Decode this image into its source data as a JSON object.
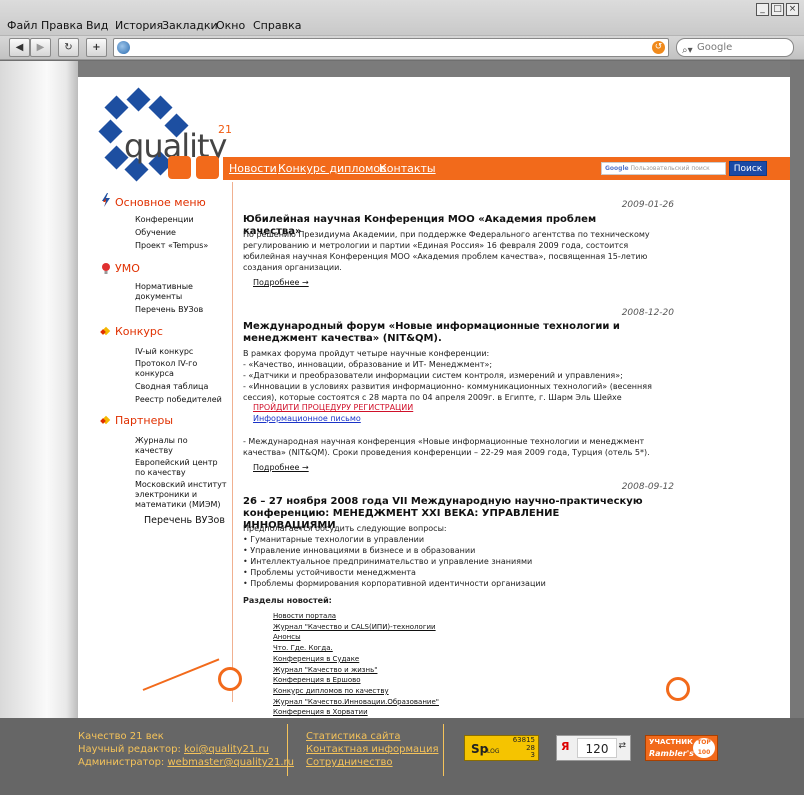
{
  "browser": {
    "menu": [
      "Файл",
      "Правка",
      "Вид",
      "История",
      "Закладки",
      "Окно",
      "Справка"
    ],
    "search_placeholder": "Google"
  },
  "site": {
    "logo_word": "quality",
    "logo_sup": "21",
    "nav": [
      "Новости",
      "Конкурс дипломов",
      "Контакты"
    ],
    "search_placeholder": "Пользовательский поиск",
    "search_button": "Поиск"
  },
  "sidebar": {
    "main_menu": {
      "title": "Основное меню",
      "items": [
        "Конференции",
        "Обучение",
        "Проект «Tempus»"
      ]
    },
    "umo": {
      "title": "УМО",
      "items": [
        "Нормативные документы",
        "Перечень ВУЗов"
      ]
    },
    "contest": {
      "title": "Конкурс",
      "items": [
        "IV-ый конкурс",
        "Протокол IV-го конкурса",
        "Сводная таблица",
        "Реестр победителей"
      ]
    },
    "partners": {
      "title": "Партнеры",
      "items": [
        "Журналы по качеству",
        "Европейский центр по качеству",
        "Московский институт электроники и математики (МИЭМ)"
      ]
    },
    "bottom": "Перечень ВУЗов"
  },
  "news": [
    {
      "date": "2009-01-26",
      "title": "Юбилейная научная Конференция МОО «Академия проблем качества»",
      "text": "По решению Президиума Академии, при поддержке Федерального агентства по техническому регулированию и метрологии и партии «Единая Россия» 16 февраля 2009 года, состоится юбилейная научная Конференция МОО «Академия проблем качества», посвященная 15-летию создания организации.",
      "more": "Подробнее →"
    },
    {
      "date": "2008-12-20",
      "title": "Международный форум «Новые информационные технологии и менеджмент качества» (NIT&QM).",
      "lines": [
        "В рамках форума пройдут четыре научные конференции:",
        "- «Качество, инновации, образование и ИТ- Менеджмент»;",
        "- «Датчики и преобразователи информации систем контроля, измерений и управления»;",
        "- «Инновации в условиях развития информационно- коммуникационных технологий» (весенняя",
        "сессия), которые состоятся с 28 марта по 04 апреля 2009г. в Египте, г. Шарм Эль Шейхе"
      ],
      "register_link": "ПРОЙДИТИ ПРОЦЕДУРУ РЕГИСТРАЦИИ",
      "info_link": "Информационное письмо",
      "extra": "- Международная научная конференция «Новые информационные технологии и менеджмент качества» (NIT&QM). Сроки проведения конференции – 22-29 мая 2009 года, Турция (отель 5*).",
      "more": "Подробнее →"
    },
    {
      "date": "2008-09-12",
      "title": "26 – 27 ноября 2008 года VII Международную научно-практическую конференцию: МЕНЕДЖМЕНТ XXI ВЕКА: УПРАВЛЕНИЕ ИННОВАЦИЯМИ",
      "intro": "Предполагается обсудить следующие вопросы:",
      "bullets": [
        "• Гуманитарные технологии в управлении",
        "• Управление инновациями в бизнесе и в образовании",
        "• Интеллектуальное предпринимательство и управление знаниями",
        "• Проблемы устойчивости менеджмента",
        "• Проблемы формирования корпоративной идентичности организации"
      ]
    }
  ],
  "sections": {
    "title": "Разделы новостей:",
    "items": [
      "Новости портала",
      "Журнал \"Качество и CALS(ИПИ)-технологии",
      "Анонсы",
      "Что. Где. Когда.",
      "Конференция в Судаке",
      "Журнал \"Качество и жизнь\"",
      "Конференция в Ершово",
      "Конкурс дипломов по качеству",
      "Журнал \"Качество.Инновации.Образование\"",
      "Конференция в Хорватии"
    ]
  },
  "footer": {
    "site_name": "Качество 21 век",
    "editor_label": "Научный редактор:",
    "editor_email": "koi@quality21.ru",
    "admin_label": "Администратор:",
    "admin_email": "webmaster@quality21.ru",
    "links": [
      "Статистика сайта",
      "Контактная информация",
      "Сотрудничество"
    ],
    "counter1": {
      "logo": "Sp",
      "sub": "LOG",
      "nums": [
        "63815",
        "28",
        "3"
      ]
    },
    "counter2": {
      "value": "120"
    },
    "counter3": {
      "line1": "УЧАСТНИК",
      "line2": "Rambler's",
      "top": "TOP 100"
    }
  },
  "colors": {
    "accent": "#f26a1b",
    "brand_blue": "#1d4fa1",
    "footer_text": "#f5c35a"
  }
}
